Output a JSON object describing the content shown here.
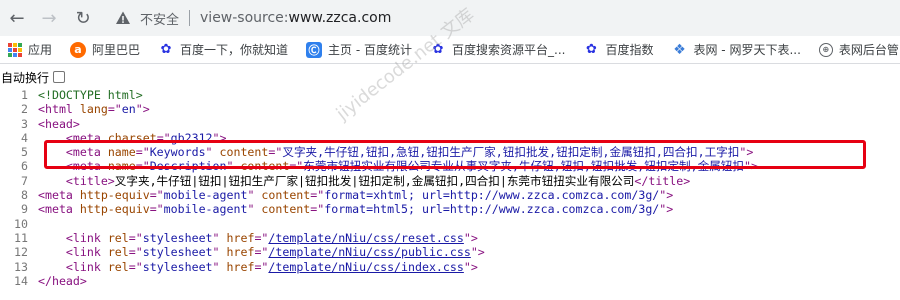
{
  "toolbar": {
    "back_glyph": "←",
    "forward_glyph": "→",
    "reload_glyph": "↻",
    "security_label": "不安全",
    "url_prefix": "view-source:",
    "url_host": "www.zzca.com"
  },
  "bookmarks": [
    {
      "label": "应用",
      "icon": "apps-grid-icon"
    },
    {
      "label": "阿里巴巴",
      "icon": "alibaba-icon"
    },
    {
      "label": "百度一下，你就知道",
      "icon": "baidu-paw-icon"
    },
    {
      "label": "主页 - 百度统计",
      "icon": "baidu-tongji-icon"
    },
    {
      "label": "百度搜索资源平台_...",
      "icon": "baidu-paw-icon"
    },
    {
      "label": "百度指数",
      "icon": "baidu-paw-icon"
    },
    {
      "label": "表网 - 网罗天下表...",
      "icon": "biaowang-icon"
    },
    {
      "label": "表网后台管",
      "icon": "globe-icon"
    }
  ],
  "wrap_label": "自动换行",
  "watermark": "jiyidecode.net 文库",
  "source": {
    "lines": [
      {
        "n": "1",
        "parts": [
          [
            "comment",
            "<!DOCTYPE html>"
          ]
        ]
      },
      {
        "n": "2",
        "parts": [
          [
            "tag",
            "<html "
          ],
          [
            "attr",
            "lang"
          ],
          [
            "tag",
            "=\""
          ],
          [
            "val",
            "en"
          ],
          [
            "tag",
            "\">"
          ]
        ]
      },
      {
        "n": "3",
        "parts": [
          [
            "tag",
            "<head>"
          ]
        ]
      },
      {
        "n": "4",
        "parts": [
          [
            "tag",
            "    <meta "
          ],
          [
            "attr",
            "charset"
          ],
          [
            "tag",
            "=\""
          ],
          [
            "val",
            "gb2312"
          ],
          [
            "tag",
            "\">"
          ]
        ]
      },
      {
        "n": "5",
        "parts": [
          [
            "tag",
            "    <meta "
          ],
          [
            "attr",
            "name"
          ],
          [
            "tag",
            "=\""
          ],
          [
            "val",
            "Keywords"
          ],
          [
            "tag",
            "\" "
          ],
          [
            "attr",
            "content"
          ],
          [
            "tag",
            "=\""
          ],
          [
            "val",
            "叉字夹,牛仔钮,钮扣,急钮,钮扣生产厂家,钮扣批发,钮扣定制,金属钮扣,四合扣,工字扣"
          ],
          [
            "tag",
            "\">"
          ]
        ]
      },
      {
        "n": "6",
        "parts": [
          [
            "tag",
            "    <meta "
          ],
          [
            "attr",
            "name"
          ],
          [
            "tag",
            "=\""
          ],
          [
            "val",
            "Description"
          ],
          [
            "tag",
            "\" "
          ],
          [
            "attr",
            "content"
          ],
          [
            "tag",
            "=\""
          ],
          [
            "val",
            "东莞市钮扭实业有限公司专业从事叉字夹,牛仔钮,钮扣,钮扣批发,钮扣定制,金属钮扣"
          ],
          [
            "tag",
            "\">"
          ]
        ]
      },
      {
        "n": "7",
        "parts": [
          [
            "tag",
            "    <title>"
          ],
          [
            "txt",
            "叉字夹,牛仔钮|钮扣|钮扣生产厂家|钮扣批发|钮扣定制,金属钮扣,四合扣|东莞市钮扭实业有限公司"
          ],
          [
            "tag",
            "</title>"
          ]
        ]
      },
      {
        "n": "8",
        "parts": [
          [
            "tag",
            "<meta "
          ],
          [
            "attr",
            "http-equiv"
          ],
          [
            "tag",
            "=\""
          ],
          [
            "val",
            "mobile-agent"
          ],
          [
            "tag",
            "\" "
          ],
          [
            "attr",
            "content"
          ],
          [
            "tag",
            "=\""
          ],
          [
            "val",
            "format=xhtml; url=http://www.zzca.comzca.com/3g/"
          ],
          [
            "tag",
            "\">"
          ]
        ]
      },
      {
        "n": "9",
        "parts": [
          [
            "tag",
            "<meta "
          ],
          [
            "attr",
            "http-equiv"
          ],
          [
            "tag",
            "=\""
          ],
          [
            "val",
            "mobile-agent"
          ],
          [
            "tag",
            "\" "
          ],
          [
            "attr",
            "content"
          ],
          [
            "tag",
            "=\""
          ],
          [
            "val",
            "format=html5; url=http://www.zzca.comzca.com/3g/"
          ],
          [
            "tag",
            "\">"
          ]
        ]
      },
      {
        "n": "10",
        "parts": []
      },
      {
        "n": "11",
        "parts": [
          [
            "tag",
            "    <link "
          ],
          [
            "attr",
            "rel"
          ],
          [
            "tag",
            "=\""
          ],
          [
            "val",
            "stylesheet"
          ],
          [
            "tag",
            "\" "
          ],
          [
            "attr",
            "href"
          ],
          [
            "tag",
            "=\""
          ],
          [
            "link",
            "/template/nNiu/css/reset.css"
          ],
          [
            "tag",
            "\">"
          ]
        ]
      },
      {
        "n": "12",
        "parts": [
          [
            "tag",
            "    <link "
          ],
          [
            "attr",
            "rel"
          ],
          [
            "tag",
            "=\""
          ],
          [
            "val",
            "stylesheet"
          ],
          [
            "tag",
            "\" "
          ],
          [
            "attr",
            "href"
          ],
          [
            "tag",
            "=\""
          ],
          [
            "link",
            "/template/nNiu/css/public.css"
          ],
          [
            "tag",
            "\">"
          ]
        ]
      },
      {
        "n": "13",
        "parts": [
          [
            "tag",
            "    <link "
          ],
          [
            "attr",
            "rel"
          ],
          [
            "tag",
            "=\""
          ],
          [
            "val",
            "stylesheet"
          ],
          [
            "tag",
            "\" "
          ],
          [
            "attr",
            "href"
          ],
          [
            "tag",
            "=\""
          ],
          [
            "link",
            "/template/nNiu/css/index.css"
          ],
          [
            "tag",
            "\">"
          ]
        ]
      },
      {
        "n": "14",
        "parts": [
          [
            "tag",
            "</head>"
          ]
        ]
      }
    ]
  },
  "colors": {
    "highlight": "#e60012",
    "tag": "#881280",
    "attr": "#994500",
    "value": "#1a1aa6",
    "comment": "#236e25"
  }
}
